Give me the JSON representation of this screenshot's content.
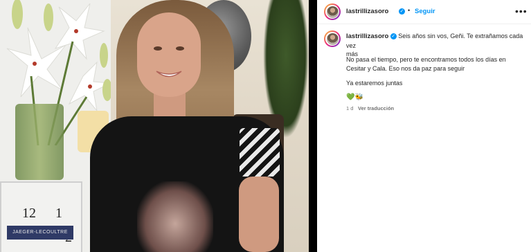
{
  "post": {
    "username": "lastrillizasoro",
    "follow_label": "Seguir",
    "more_label": "•••",
    "caption_line1": "Seis años sin vos, Geñi. Te extrañamos cada vez",
    "caption_line2": "más",
    "body_line1": "No pasa el tiempo, pero te encontramos todos los días en",
    "body_line2": "Cesitar y Cala. Eso nos da paz para seguir",
    "body_line3": "Ya estaremos juntas",
    "emojis": "💚🐝",
    "time_ago": "1 d",
    "see_translation": "Ver traducción"
  },
  "photo": {
    "clock_numbers": [
      "12",
      "1",
      "2"
    ],
    "clock_brand": "JAEGER-LECOULTRE"
  },
  "colors": {
    "link_blue": "#0095f6",
    "text_primary": "#262626",
    "text_secondary": "#737373"
  },
  "icons": {
    "verified": "verified-badge-icon",
    "more": "more-options-icon"
  }
}
